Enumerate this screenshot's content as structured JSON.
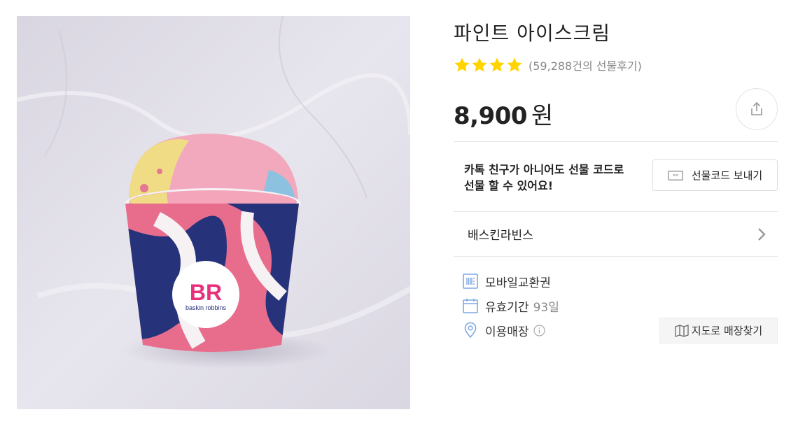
{
  "product": {
    "title": "파인트 아이스크림",
    "star_count": 4,
    "review_text": "(59,288건의 선물후기)",
    "price_amount": "8,900",
    "price_unit": "원",
    "image_alt": "Baskin Robbins pint ice cream cup",
    "image_brand_mark": "BR",
    "image_brand_text": "baskin robbins"
  },
  "gift": {
    "text_line1": "카톡 친구가 아니어도 선물 코드로",
    "text_line2": "선물 할 수 있어요!",
    "button_label": "선물코드 보내기"
  },
  "brand": {
    "name": "배스킨라빈스"
  },
  "details": {
    "voucher_label": "모바일교환권",
    "validity_label": "유효기간",
    "validity_value": "93일",
    "store_label": "이용매장",
    "map_button_label": "지도로 매장찾기"
  },
  "colors": {
    "star": "#ffd400",
    "accent_blue": "#7da9e3",
    "text_muted": "#888888",
    "divider": "#e6e6e6"
  },
  "icons": {
    "share": "share-icon",
    "code": "gift-code-icon",
    "chevron": "chevron-right-icon",
    "voucher": "barcode-ticket-icon",
    "calendar": "calendar-icon",
    "location": "location-pin-icon",
    "info": "info-icon",
    "map": "map-icon"
  }
}
